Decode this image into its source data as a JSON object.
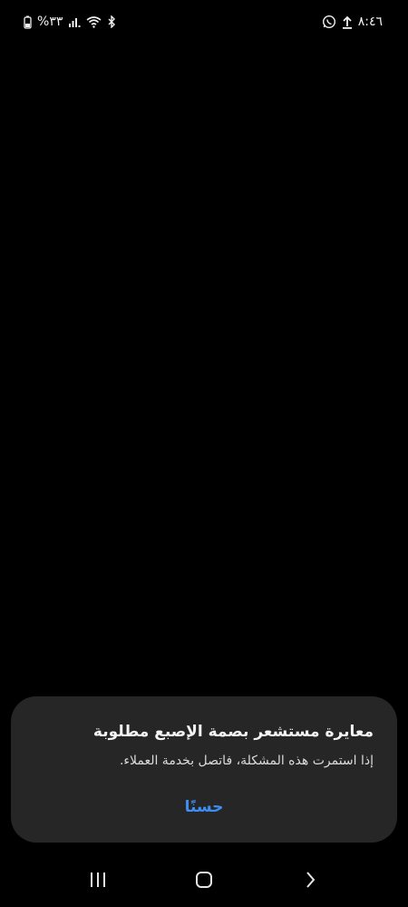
{
  "status_bar": {
    "time": "٨:٤٦",
    "battery": "%٣٣",
    "icons": [
      "whatsapp-icon",
      "upload-icon",
      "signal-icon",
      "wifi-icon",
      "bluetooth-icon",
      "battery-icon"
    ]
  },
  "dialog": {
    "title": "معايرة مستشعر بصمة الإصبع مطلوبة",
    "message": "إذا استمرت هذه المشكلة، فاتصل بخدمة العملاء.",
    "ok_label": "حسنًا",
    "accent_color": "#3d8ef2",
    "background_color": "#262626"
  },
  "nav_bar": {
    "icons": [
      "recents-icon",
      "home-icon",
      "back-icon"
    ]
  }
}
